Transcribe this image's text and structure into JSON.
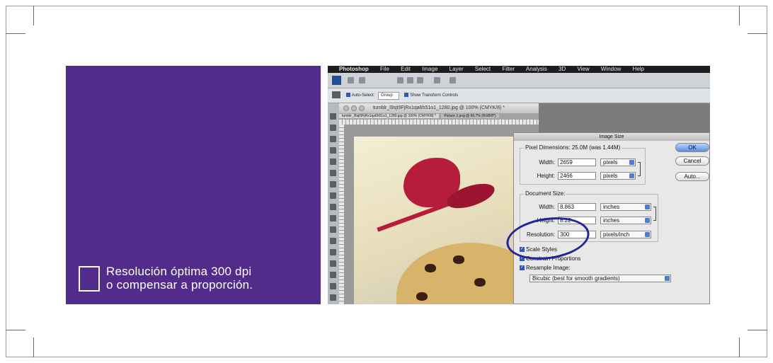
{
  "caption": {
    "line1": "Resolución óptima 300 dpi",
    "line2": "o compensar a proporción."
  },
  "colors": {
    "panel": "#512c8a",
    "caption_text": "#ffffff",
    "annotation_circle": "#24249a"
  },
  "screenshot": {
    "menu": [
      "Photoshop",
      "File",
      "Edit",
      "Image",
      "Layer",
      "Select",
      "Filter",
      "Analysis",
      "3D",
      "View",
      "Window",
      "Help"
    ],
    "options_bar": {
      "auto_select": "Auto-Select:",
      "auto_select_value": "Group",
      "show_transform": "Show Transform Controls"
    },
    "document": {
      "title": "tumblr_l9sjt9FjRx1qa6h51o1_1280.jpg @ 100% (CMYK/8) *",
      "tabs": [
        "tumblr_l9sjt9FjRx1qa6h51o1_1280.jpg @ 100% (CMYK/8) *",
        "Picture 2.png @ 66.7% (RGB/8*)"
      ]
    },
    "dialog": {
      "title": "Image Size",
      "pixel_dimensions": {
        "label": "Pixel Dimensions:",
        "summary": "25.0M (was 1.44M)",
        "width_label": "Width:",
        "width_value": "2659",
        "width_unit": "pixels",
        "height_label": "Height:",
        "height_value": "2466",
        "height_unit": "pixels"
      },
      "document_size": {
        "label": "Document Size:",
        "width_label": "Width:",
        "width_value": "8.863",
        "width_unit": "inches",
        "height_label": "Height:",
        "height_value": "8.22",
        "height_unit": "inches",
        "resolution_label": "Resolution:",
        "resolution_value": "300",
        "resolution_unit": "pixels/inch"
      },
      "buttons": {
        "ok": "OK",
        "cancel": "Cancel",
        "auto": "Auto..."
      },
      "checkboxes": {
        "scale_styles": "Scale Styles",
        "constrain": "Constrain Proportions",
        "resample": "Resample Image:"
      },
      "resample_method": "Bicubic (best for smooth gradients)"
    }
  }
}
